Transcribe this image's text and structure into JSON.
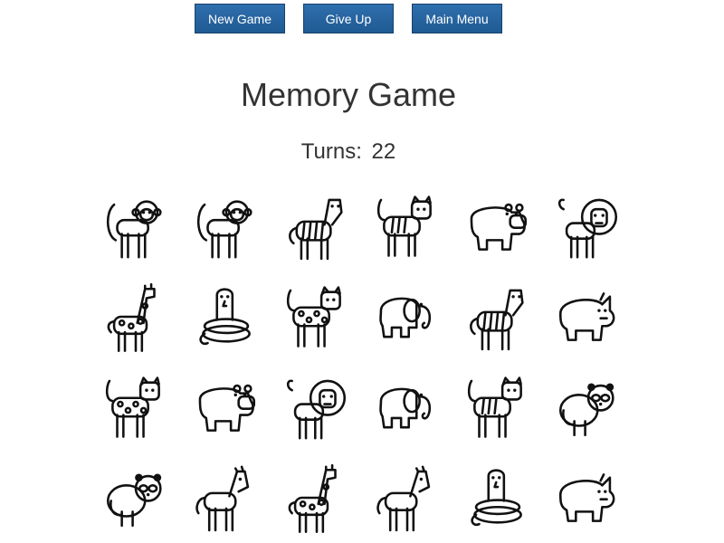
{
  "toolbar": {
    "new_game": "New Game",
    "give_up": "Give Up",
    "main_menu": "Main Menu"
  },
  "title": "Memory Game",
  "turns": {
    "label": "Turns:",
    "value": "22"
  },
  "board": {
    "columns": 6,
    "cards": [
      "monkey",
      "monkey",
      "zebra",
      "tiger",
      "hippo",
      "lion",
      "giraffe",
      "snake",
      "leopard",
      "elephant",
      "zebra",
      "rhino",
      "leopard",
      "hippo",
      "lion",
      "elephant",
      "tiger",
      "panda",
      "panda",
      "horse",
      "giraffe",
      "horse",
      "snake",
      "rhino"
    ]
  }
}
